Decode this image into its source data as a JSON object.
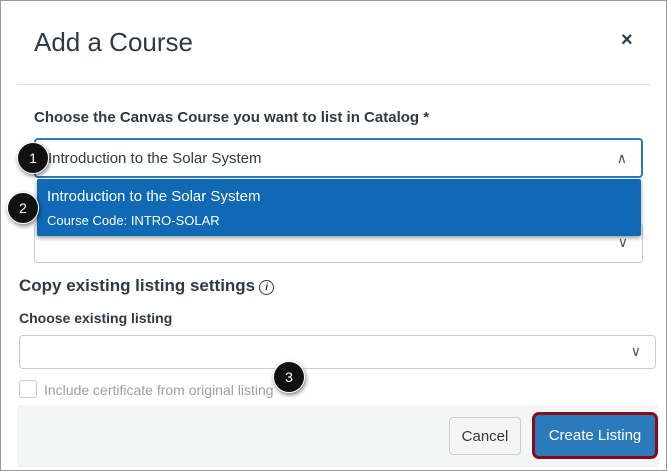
{
  "dialog": {
    "title": "Add a Course",
    "close_icon": "×"
  },
  "course_field": {
    "label": "Choose the Canvas Course you want to list in Catalog *",
    "value": "Introduction to the Solar System"
  },
  "dropdown": {
    "option_title": "Introduction to the Solar System",
    "option_code": "Course Code: INTRO-SOLAR"
  },
  "copy_section": {
    "heading": "Copy existing listing settings",
    "info_icon": "i",
    "listing_label": "Choose existing listing",
    "checkbox_label": "Include certificate from original listing"
  },
  "footer": {
    "cancel": "Cancel",
    "create": "Create Listing"
  },
  "badges": [
    "1",
    "2",
    "3"
  ],
  "colors": {
    "accent": "#2b7abc",
    "highlight": "#0f69b4",
    "callout_border": "#8b0a15"
  }
}
